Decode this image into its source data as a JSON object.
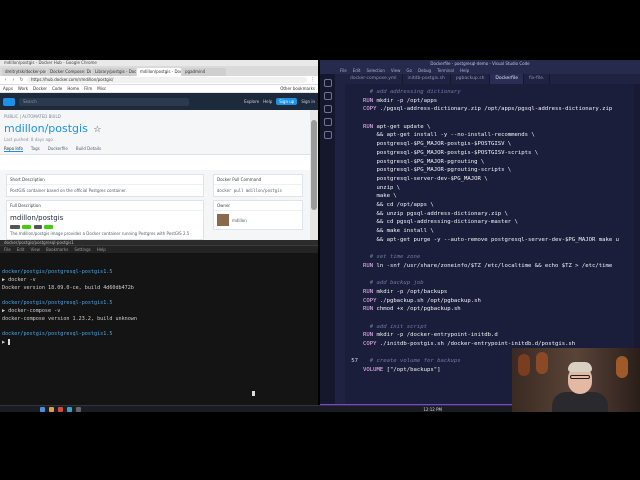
{
  "browser": {
    "window_title": "mdillon/postgis - Docker Hub - Google Chrome",
    "tabs": [
      {
        "label": "dmitrytsk/docker-postgis"
      },
      {
        "label": "Docker Compose: Docker"
      },
      {
        "label": "Library/postgis - Docke"
      },
      {
        "label": "mdillon/postgis - Docke"
      },
      {
        "label": "pgadmin4"
      }
    ],
    "url": "https://hub.docker.com/r/mdillon/postgis/",
    "bookmarks": [
      "Apps",
      "Work",
      "Docker",
      "Code",
      "Home",
      "Film",
      "Misc",
      "Other bookmarks"
    ],
    "hub_search_placeholder": "Search",
    "hub_nav": [
      "Explore",
      "Help"
    ],
    "hub_signup": "Sign up",
    "hub_signin": "Sign in",
    "repo_tag": "PUBLIC | AUTOMATED BUILD",
    "repo_owner": "mdillon",
    "repo_name": "postgis",
    "repo_updated": "Last pushed: 8 days ago",
    "repo_tabs": [
      "Repo Info",
      "Tags",
      "Dockerfile",
      "Build Details"
    ],
    "short_desc_title": "Short Description",
    "short_desc": "PostGIS container based on the official Postgres container.",
    "full_desc_title": "Full Description",
    "full_desc_heading": "mdillon/postgis",
    "full_desc_text": "The mdillon/postgis image provides a Docker container running Postgres with PostGIS 2.5",
    "pull_title": "Docker Pull Command",
    "pull_cmd": "docker pull mdillon/postgis",
    "owner_title": "Owner",
    "owner_name": "mdillon"
  },
  "terminal": {
    "title": "docker/postgis/postgresql-postgis1",
    "menu": [
      "File",
      "Edit",
      "View",
      "Bookmarks",
      "Settings",
      "Help"
    ],
    "lines": [
      {
        "kind": "prompt",
        "text": "docker/postgis/postgresql-postgis1.5"
      },
      {
        "kind": "cmd",
        "text": "▶ docker -v"
      },
      {
        "kind": "out",
        "text": "Docker version 18.09.0-ce, build 4d60db472b"
      },
      {
        "kind": "blank",
        "text": ""
      },
      {
        "kind": "prompt",
        "text": "docker/postgis/postgresql-postgis1.5"
      },
      {
        "kind": "cmd",
        "text": "▶ docker-compose -v"
      },
      {
        "kind": "out",
        "text": "docker-compose version 1.23.2, build unknown"
      },
      {
        "kind": "blank",
        "text": ""
      },
      {
        "kind": "prompt",
        "text": "docker/postgis/postgresql-postgis1.5"
      },
      {
        "kind": "cmd",
        "text": "▶ "
      }
    ]
  },
  "vscode": {
    "window_title": "Dockerfile - postgresql-demo - Visual Studio Code",
    "menu": [
      "File",
      "Edit",
      "Selection",
      "View",
      "Go",
      "Debug",
      "Terminal",
      "Help"
    ],
    "tabs": [
      {
        "label": "docker-compose.yml",
        "active": false
      },
      {
        "label": "initdb-postgis.sh",
        "active": false
      },
      {
        "label": "pgbackup.sh",
        "active": false
      },
      {
        "label": "Dockerfile",
        "active": true
      },
      {
        "label": "fix-file.",
        "active": false
      }
    ],
    "code": [
      {
        "n": "",
        "segs": [
          {
            "c": "cm",
            "t": "  # add addressing dictionary"
          }
        ]
      },
      {
        "n": "",
        "segs": [
          {
            "c": "kw",
            "t": "RUN "
          },
          {
            "c": "tx",
            "t": "mkdir -p /opt/apps"
          }
        ]
      },
      {
        "n": "",
        "segs": [
          {
            "c": "kw",
            "t": "COPY "
          },
          {
            "c": "tx",
            "t": "./pgsql-address-dictionary.zip /opt/apps/pgsql-address-dictionary.zip"
          }
        ]
      },
      {
        "n": "",
        "segs": [
          {
            "c": "tx",
            "t": ""
          }
        ]
      },
      {
        "n": "",
        "segs": [
          {
            "c": "kw",
            "t": "RUN "
          },
          {
            "c": "tx",
            "t": "apt-get update \\"
          }
        ]
      },
      {
        "n": "",
        "segs": [
          {
            "c": "tx",
            "t": "    && apt-get install -y --no-install-recommends \\"
          }
        ]
      },
      {
        "n": "",
        "segs": [
          {
            "c": "tx",
            "t": "    postgresql-$PG_MAJOR-postgis-$POSTGISV \\"
          }
        ]
      },
      {
        "n": "",
        "segs": [
          {
            "c": "tx",
            "t": "    postgresql-$PG_MAJOR-postgis-$POSTGISV-scripts \\"
          }
        ]
      },
      {
        "n": "",
        "segs": [
          {
            "c": "tx",
            "t": "    postgresql-$PG_MAJOR-pgrouting \\"
          }
        ]
      },
      {
        "n": "",
        "segs": [
          {
            "c": "tx",
            "t": "    postgresql-$PG_MAJOR-pgrouting-scripts \\"
          }
        ]
      },
      {
        "n": "",
        "segs": [
          {
            "c": "tx",
            "t": "    postgresql-server-dev-$PG_MAJOR \\"
          }
        ]
      },
      {
        "n": "",
        "segs": [
          {
            "c": "tx",
            "t": "    unzip \\"
          }
        ]
      },
      {
        "n": "",
        "segs": [
          {
            "c": "tx",
            "t": "    make \\"
          }
        ]
      },
      {
        "n": "",
        "segs": [
          {
            "c": "tx",
            "t": "    && cd /opt/apps \\"
          }
        ]
      },
      {
        "n": "",
        "segs": [
          {
            "c": "tx",
            "t": "    && unzip pgsql-address-dictionary.zip \\"
          }
        ]
      },
      {
        "n": "",
        "segs": [
          {
            "c": "tx",
            "t": "    && cd pgsql-addressing-dictionary-master \\"
          }
        ]
      },
      {
        "n": "",
        "segs": [
          {
            "c": "tx",
            "t": "    && make install \\"
          }
        ]
      },
      {
        "n": "",
        "segs": [
          {
            "c": "tx",
            "t": "    && apt-get purge -y --auto-remove postgresql-server-dev-$PG_MAJOR make u"
          }
        ]
      },
      {
        "n": "",
        "segs": [
          {
            "c": "tx",
            "t": ""
          }
        ]
      },
      {
        "n": "",
        "segs": [
          {
            "c": "cm",
            "t": "  # set time zone"
          }
        ]
      },
      {
        "n": "",
        "segs": [
          {
            "c": "kw",
            "t": "RUN "
          },
          {
            "c": "tx",
            "t": "ln -snf /usr/share/zoneinfo/$TZ /etc/localtime && echo $TZ > /etc/time"
          }
        ]
      },
      {
        "n": "",
        "segs": [
          {
            "c": "tx",
            "t": ""
          }
        ]
      },
      {
        "n": "",
        "segs": [
          {
            "c": "cm",
            "t": "  # add backup job"
          }
        ]
      },
      {
        "n": "",
        "segs": [
          {
            "c": "kw",
            "t": "RUN "
          },
          {
            "c": "tx",
            "t": "mkdir -p /opt/backups"
          }
        ]
      },
      {
        "n": "",
        "segs": [
          {
            "c": "kw",
            "t": "COPY "
          },
          {
            "c": "tx",
            "t": "./pgbackup.sh /opt/pgbackup.sh"
          }
        ]
      },
      {
        "n": "",
        "segs": [
          {
            "c": "kw",
            "t": "RUN "
          },
          {
            "c": "tx",
            "t": "chmod +x /opt/pgbackup.sh"
          }
        ]
      },
      {
        "n": "",
        "segs": [
          {
            "c": "tx",
            "t": ""
          }
        ]
      },
      {
        "n": "",
        "segs": [
          {
            "c": "cm",
            "t": "  # add init script"
          }
        ]
      },
      {
        "n": "",
        "segs": [
          {
            "c": "kw",
            "t": "RUN "
          },
          {
            "c": "tx",
            "t": "mkdir -p /docker-entrypoint-initdb.d"
          }
        ]
      },
      {
        "n": "",
        "segs": [
          {
            "c": "kw",
            "t": "COPY "
          },
          {
            "c": "tx",
            "t": "./initdb-postgis.sh /docker-entrypoint-initdb.d/postgis.sh"
          }
        ]
      },
      {
        "n": "",
        "segs": [
          {
            "c": "tx",
            "t": ""
          }
        ]
      },
      {
        "n": "57",
        "segs": [
          {
            "c": "cm",
            "t": "  # create volume for backups"
          }
        ]
      },
      {
        "n": "",
        "segs": [
          {
            "c": "kw",
            "t": "VOLUME "
          },
          {
            "c": "tx",
            "t": "[\"/opt/backups\"]"
          }
        ]
      }
    ],
    "status_left": "⎇ master",
    "status_right": "Ln 57, Col 30"
  },
  "taskbar": {
    "clock": "12:12 PM"
  }
}
